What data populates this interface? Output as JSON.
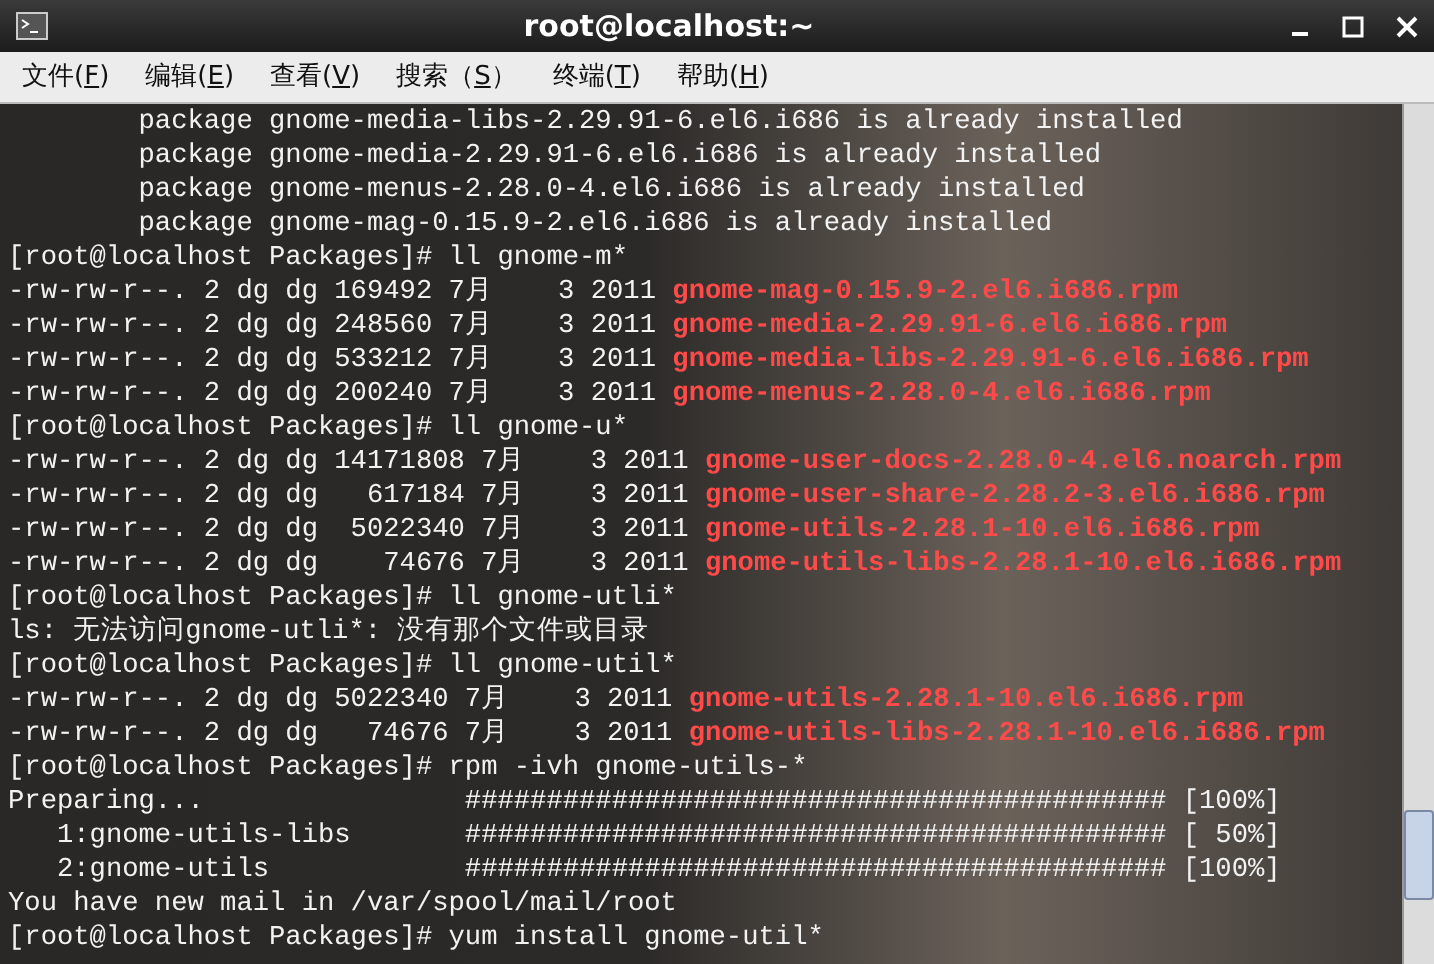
{
  "window": {
    "title": "root@localhost:~"
  },
  "menu": [
    {
      "before": "文件(",
      "key": "F",
      "after": ")"
    },
    {
      "before": "编辑(",
      "key": "E",
      "after": ")"
    },
    {
      "before": "查看(",
      "key": "V",
      "after": ")"
    },
    {
      "before": "搜索（",
      "key": "S",
      "after": "）"
    },
    {
      "before": "终端(",
      "key": "T",
      "after": ")"
    },
    {
      "before": "帮助(",
      "key": "H",
      "after": ")"
    }
  ],
  "terminal": {
    "lines": [
      {
        "text": "        package gnome-media-libs-2.29.91-6.el6.i686 is already installed"
      },
      {
        "text": "        package gnome-media-2.29.91-6.el6.i686 is already installed"
      },
      {
        "text": "        package gnome-menus-2.28.0-4.el6.i686 is already installed"
      },
      {
        "text": "        package gnome-mag-0.15.9-2.el6.i686 is already installed"
      },
      {
        "text": "[root@localhost Packages]# ll gnome-m*"
      },
      {
        "text": "-rw-rw-r--. 2 dg dg 169492 7月    3 2011 ",
        "file": "gnome-mag-0.15.9-2.el6.i686.rpm"
      },
      {
        "text": "-rw-rw-r--. 2 dg dg 248560 7月    3 2011 ",
        "file": "gnome-media-2.29.91-6.el6.i686.rpm"
      },
      {
        "text": "-rw-rw-r--. 2 dg dg 533212 7月    3 2011 ",
        "file": "gnome-media-libs-2.29.91-6.el6.i686.rpm"
      },
      {
        "text": "-rw-rw-r--. 2 dg dg 200240 7月    3 2011 ",
        "file": "gnome-menus-2.28.0-4.el6.i686.rpm"
      },
      {
        "text": "[root@localhost Packages]# ll gnome-u*"
      },
      {
        "text": "-rw-rw-r--. 2 dg dg 14171808 7月    3 2011 ",
        "file": "gnome-user-docs-2.28.0-4.el6.noarch.rpm"
      },
      {
        "text": "-rw-rw-r--. 2 dg dg   617184 7月    3 2011 ",
        "file": "gnome-user-share-2.28.2-3.el6.i686.rpm"
      },
      {
        "text": "-rw-rw-r--. 2 dg dg  5022340 7月    3 2011 ",
        "file": "gnome-utils-2.28.1-10.el6.i686.rpm"
      },
      {
        "text": "-rw-rw-r--. 2 dg dg    74676 7月    3 2011 ",
        "file": "gnome-utils-libs-2.28.1-10.el6.i686.rpm"
      },
      {
        "text": "[root@localhost Packages]# ll gnome-utli*"
      },
      {
        "text": "ls: 无法访问gnome-utli*: 没有那个文件或目录"
      },
      {
        "text": "[root@localhost Packages]# ll gnome-util*"
      },
      {
        "text": "-rw-rw-r--. 2 dg dg 5022340 7月    3 2011 ",
        "file": "gnome-utils-2.28.1-10.el6.i686.rpm"
      },
      {
        "text": "-rw-rw-r--. 2 dg dg   74676 7月    3 2011 ",
        "file": "gnome-utils-libs-2.28.1-10.el6.i686.rpm"
      },
      {
        "text": "[root@localhost Packages]# rpm -ivh gnome-utils-*"
      },
      {
        "text": "Preparing...                ########################################### [100%]"
      },
      {
        "text": "   1:gnome-utils-libs       ########################################### [ 50%]"
      },
      {
        "text": "   2:gnome-utils            ########################################### [100%]"
      },
      {
        "text": "You have new mail in /var/spool/mail/root"
      },
      {
        "text": "[root@localhost Packages]# yum install gnome-util*"
      }
    ]
  }
}
